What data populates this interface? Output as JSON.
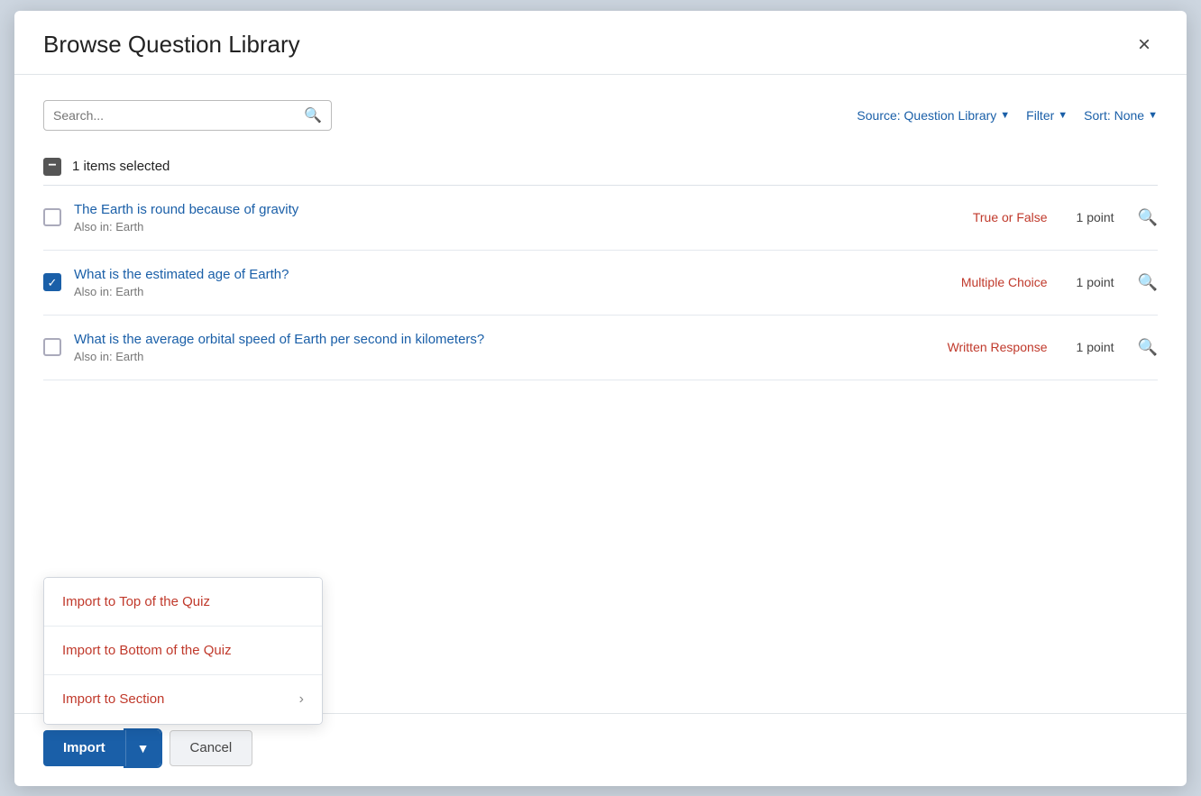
{
  "modal": {
    "title": "Browse Question Library",
    "close_label": "×"
  },
  "search": {
    "placeholder": "Search...",
    "icon": "🔍"
  },
  "toolbar": {
    "source_label": "Source: Question Library",
    "filter_label": "Filter",
    "sort_label": "Sort: None"
  },
  "selection": {
    "count": "1",
    "label": "items selected"
  },
  "questions": [
    {
      "id": "q1",
      "title": "The Earth is round because of gravity",
      "subtitle": "Also in: Earth",
      "type": "True or False",
      "points": "1 point",
      "checked": false
    },
    {
      "id": "q2",
      "title": "What is the estimated age of Earth?",
      "subtitle": "Also in: Earth",
      "type": "Multiple Choice",
      "points": "1 point",
      "checked": true
    },
    {
      "id": "q3",
      "title": "What is the average orbital speed of Earth per second in kilometers?",
      "subtitle": "Also in: Earth",
      "type": "Written Response",
      "points": "1 point",
      "checked": false
    }
  ],
  "dropdown": {
    "items": [
      {
        "label": "Import to Top of the Quiz",
        "has_arrow": false
      },
      {
        "label": "Import to Bottom of the Quiz",
        "has_arrow": false
      },
      {
        "label": "Import to Section",
        "has_arrow": true
      }
    ]
  },
  "footer": {
    "import_label": "Import",
    "cancel_label": "Cancel"
  }
}
